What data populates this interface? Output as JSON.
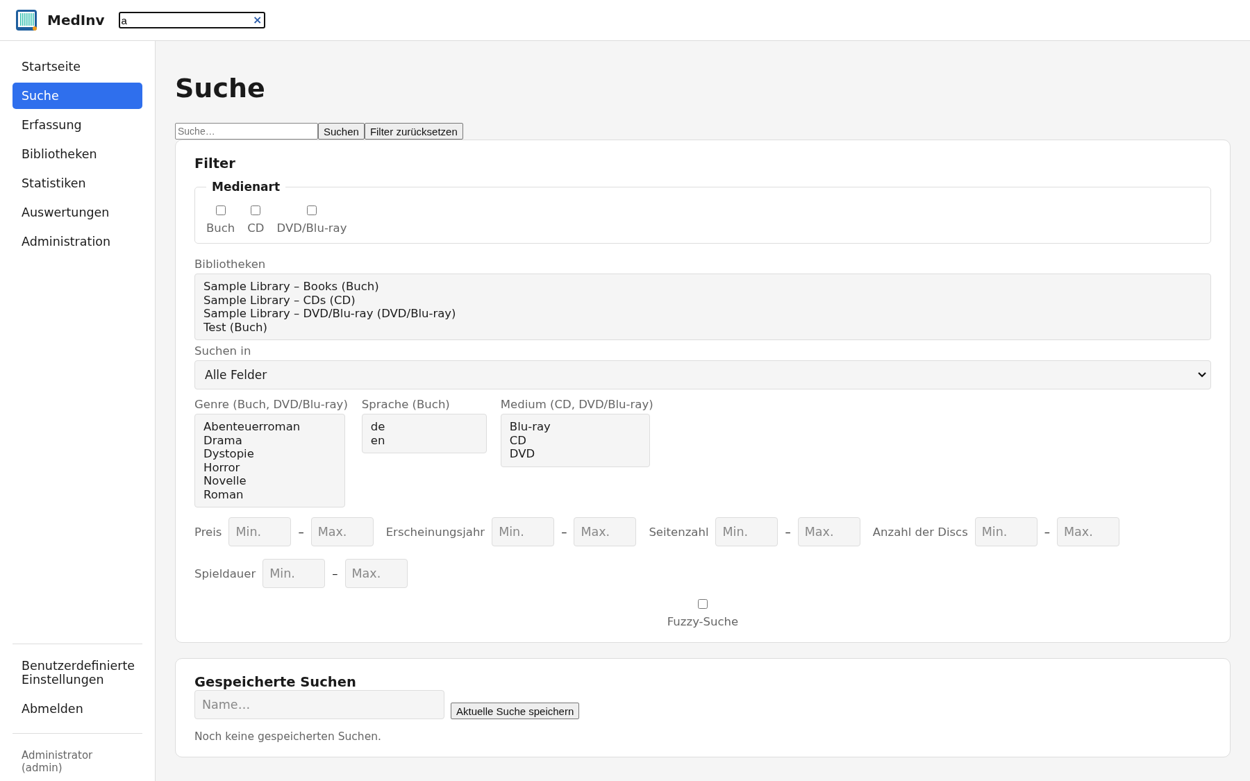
{
  "header": {
    "app_name": "MedInv",
    "search": {
      "value": "a",
      "clear": "×"
    }
  },
  "sidebar": {
    "items": [
      {
        "label": "Startseite",
        "selected": false
      },
      {
        "label": "Suche",
        "selected": true
      },
      {
        "label": "Erfassung",
        "selected": false
      },
      {
        "label": "Bibliotheken",
        "selected": false
      },
      {
        "label": "Statistiken",
        "selected": false
      },
      {
        "label": "Auswertungen",
        "selected": false
      },
      {
        "label": "Administration",
        "selected": false
      }
    ],
    "bottom_items": [
      {
        "label": "Benutzerdefinierte Einstellungen"
      },
      {
        "label": "Abmelden"
      }
    ],
    "user": "Administrator (admin)"
  },
  "page": {
    "title": "Suche",
    "search": {
      "placeholder": "Suche…",
      "buttons": [
        "Suchen",
        "Filter zurücksetzen"
      ]
    },
    "filter": {
      "title": "Filter",
      "media_type": {
        "legend": "Medienart",
        "options": [
          {
            "label": "Buch",
            "checked": false
          },
          {
            "label": "CD",
            "checked": false
          },
          {
            "label": "DVD/Blu-ray",
            "checked": false
          }
        ]
      },
      "libraries": {
        "label": "Bibliotheken",
        "options": [
          "Sample Library – Books (Buch)",
          "Sample Library – CDs (CD)",
          "Sample Library – DVD/Blu-ray (DVD/Blu-ray)",
          "Test (Buch)"
        ]
      },
      "search_in": {
        "label": "Suchen in",
        "value": "Alle Felder"
      },
      "lists": [
        {
          "label": "Genre (Buch, DVD/Blu-ray)",
          "options": [
            "Abenteuerroman",
            "Drama",
            "Dystopie",
            "Horror",
            "Novelle",
            "Roman"
          ]
        },
        {
          "label": "Sprache (Buch)",
          "options": [
            "de",
            "en"
          ]
        },
        {
          "label": "Medium (CD, DVD/Blu-ray)",
          "options": [
            "Blu-ray",
            "CD",
            "DVD"
          ]
        }
      ],
      "ranges": [
        {
          "label": "Preis",
          "min_placeholder": "Min.",
          "separator": "–",
          "max_placeholder": "Max."
        },
        {
          "label": "Erscheinungsjahr",
          "min_placeholder": "Min.",
          "separator": "–",
          "max_placeholder": "Max."
        },
        {
          "label": "Seitenzahl",
          "min_placeholder": "Min.",
          "separator": "–",
          "max_placeholder": "Max."
        },
        {
          "label": "Anzahl der Discs",
          "min_placeholder": "Min.",
          "separator": "–",
          "max_placeholder": "Max."
        },
        {
          "label": "Spieldauer",
          "min_placeholder": "Min.",
          "separator": "–",
          "max_placeholder": "Max."
        }
      ],
      "fuzzy": {
        "label": "Fuzzy-Suche",
        "checked": false
      }
    },
    "saved": {
      "title": "Gespeicherte Suchen",
      "placeholder": "Name…",
      "button": "Aktuelle Suche speichern",
      "empty": "Noch keine gespeicherten Suchen."
    }
  }
}
